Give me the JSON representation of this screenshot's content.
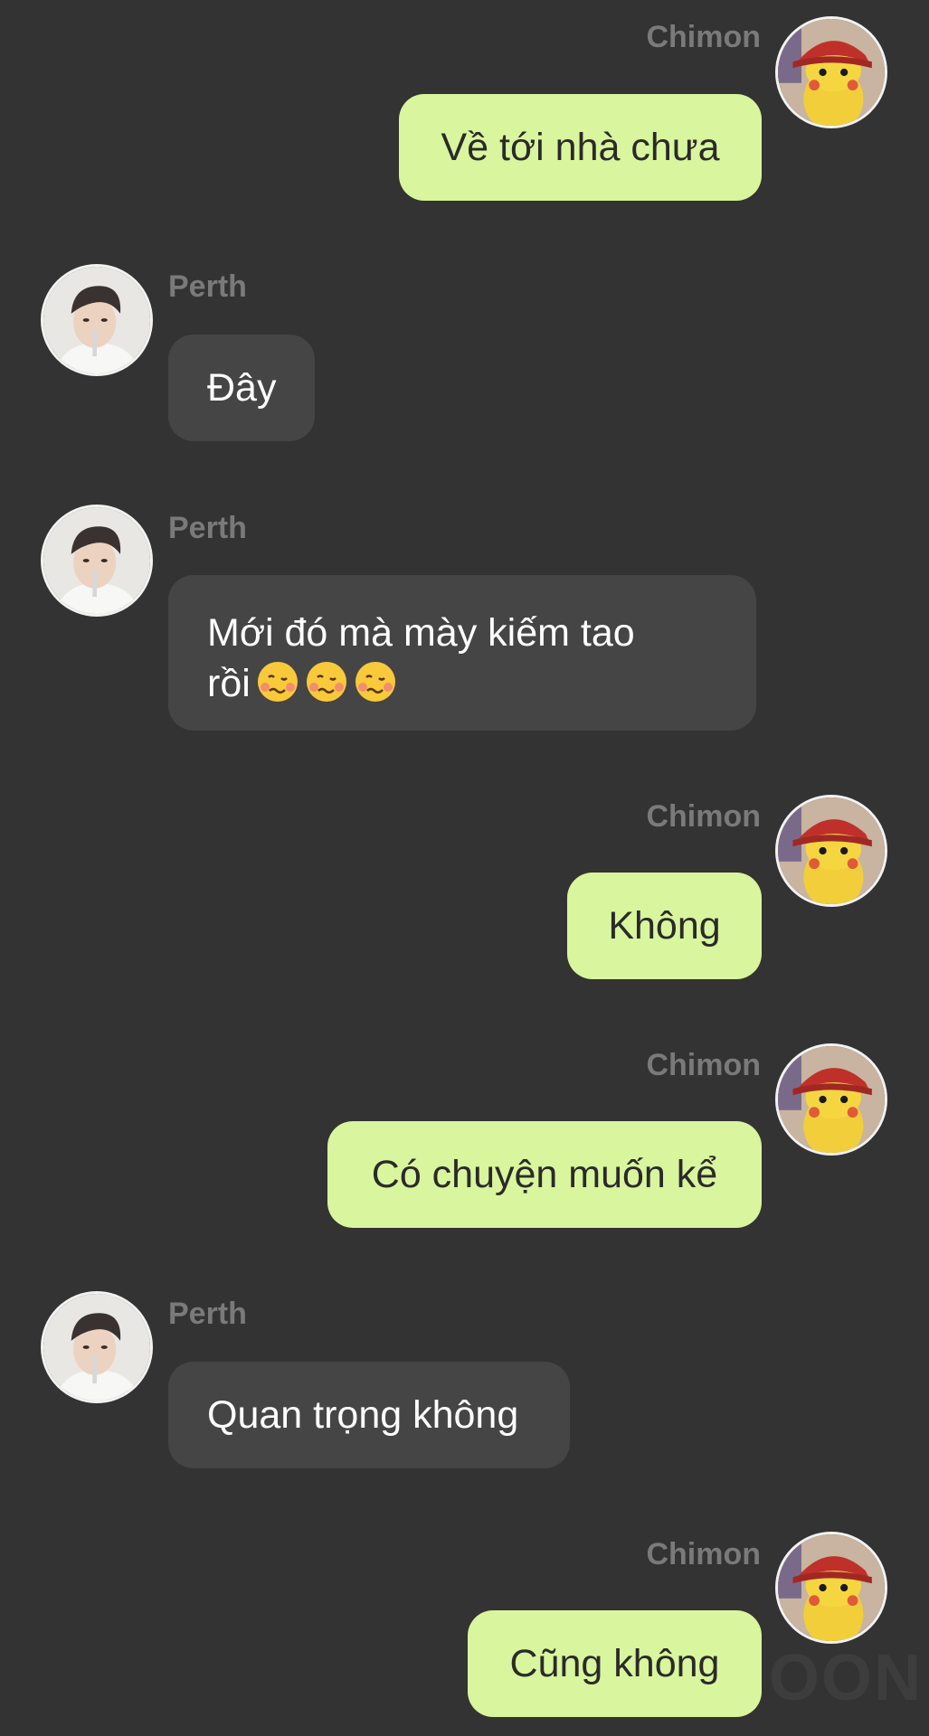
{
  "messages": [
    {
      "sender": "Chimon",
      "side": "right",
      "text": "Về tới nhà chưa"
    },
    {
      "sender": "Perth",
      "side": "left",
      "text": "Đây"
    },
    {
      "sender": "Perth",
      "side": "left",
      "text": "Mới đó mà mày kiếm tao rồi",
      "emoji": [
        "woozy-face-icon",
        "woozy-face-icon",
        "woozy-face-icon"
      ]
    },
    {
      "sender": "Chimon",
      "side": "right",
      "text": "Không"
    },
    {
      "sender": "Chimon",
      "side": "right",
      "text": "Có chuyện muốn kể"
    },
    {
      "sender": "Perth",
      "side": "left",
      "text": "Quan trọng không"
    },
    {
      "sender": "Chimon",
      "side": "right",
      "text": "Cũng không"
    }
  ],
  "watermark": "OON",
  "colors": {
    "background": "#333333",
    "outgoing_bubble": "#d9f59d",
    "incoming_bubble": "#454545",
    "sender_name": "#7a7a7a"
  }
}
